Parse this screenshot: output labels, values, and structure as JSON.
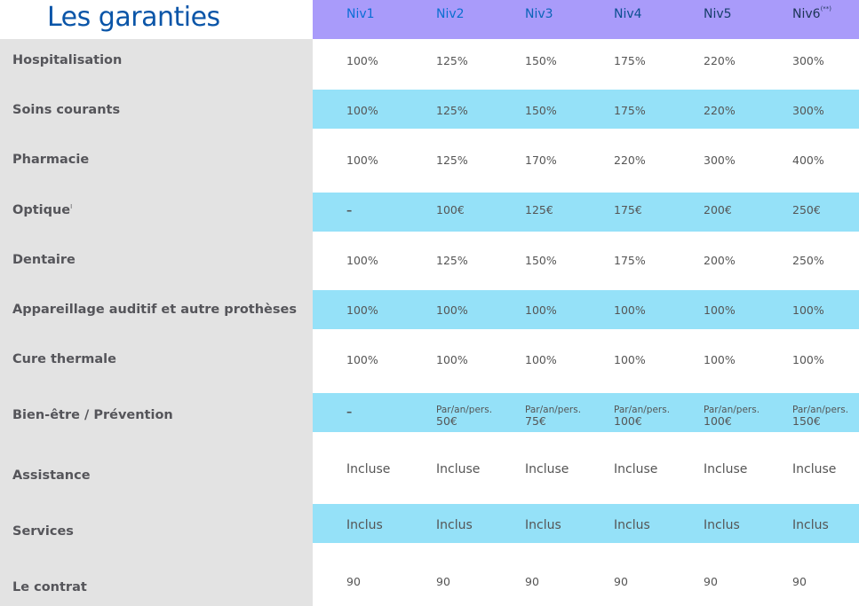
{
  "title": "Les garanties",
  "columns": [
    {
      "label": "Niv1",
      "color": "#0a6ed6"
    },
    {
      "label": "Niv2",
      "color": "#0a6fd0"
    },
    {
      "label": "Niv3",
      "color": "#0a64b8"
    },
    {
      "label": "Niv4",
      "color": "#0b4f90"
    },
    {
      "label": "Niv5",
      "color": "#163e6a"
    },
    {
      "label": "Niv6",
      "color": "#1d3556",
      "sup": "(**)"
    }
  ],
  "colors": {
    "header_bg": "#a99bfa",
    "band_blue": "#95e1f8",
    "label_col_bg": "#e3e3e3",
    "title": "#0a55a8",
    "text": "#555555"
  },
  "rows": [
    {
      "label": "Hospitalisation",
      "values": [
        "100%",
        "125%",
        "150%",
        "175%",
        "220%",
        "300%"
      ]
    },
    {
      "label": "Soins courants",
      "values": [
        "100%",
        "125%",
        "150%",
        "175%",
        "220%",
        "300%"
      ]
    },
    {
      "label": "Pharmacie",
      "values": [
        "100%",
        "125%",
        "170%",
        "220%",
        "300%",
        "400%"
      ]
    },
    {
      "label": "Optique",
      "sup": "I",
      "values": [
        "–",
        "100€",
        "125€",
        "175€",
        "200€",
        "250€"
      ]
    },
    {
      "label": "Dentaire",
      "values": [
        "100%",
        "125%",
        "150%",
        "175%",
        "200%",
        "250%"
      ]
    },
    {
      "label": "Appareillage auditif et autre prothèses",
      "values": [
        "100%",
        "100%",
        "100%",
        "100%",
        "100%",
        "100%"
      ]
    },
    {
      "label": "Cure thermale",
      "values": [
        "100%",
        "100%",
        "100%",
        "100%",
        "100%",
        "100%"
      ]
    },
    {
      "label": "Bien-être / Prévention",
      "values": [
        {
          "text": "–"
        },
        {
          "prefix": "Par/an/pers.",
          "amount": "50€"
        },
        {
          "prefix": "Par/an/pers.",
          "amount": "75€"
        },
        {
          "prefix": "Par/an/pers.",
          "amount": "100€"
        },
        {
          "prefix": "Par/an/pers.",
          "amount": "100€"
        },
        {
          "prefix": "Par/an/pers.",
          "amount": "150€"
        }
      ]
    },
    {
      "label": "Assistance",
      "values": [
        "Incluse",
        "Incluse",
        "Incluse",
        "Incluse",
        "Incluse",
        "Incluse"
      ]
    },
    {
      "label": "Services",
      "values": [
        "Inclus",
        "Inclus",
        "Inclus",
        "Inclus",
        "Inclus",
        "Inclus"
      ]
    },
    {
      "label": "Le contrat",
      "values": [
        "90",
        "90",
        "90",
        "90",
        "90",
        "90"
      ]
    }
  ]
}
